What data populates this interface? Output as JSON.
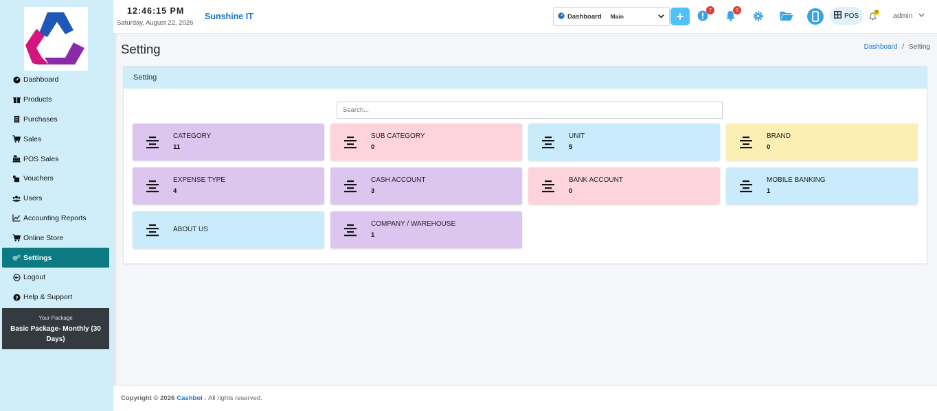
{
  "topbar": {
    "time": "12:46:15 PM",
    "date": "Saturday, August 22, 2026",
    "company": "Sunshine IT",
    "dashboard_label": "Dashboard",
    "dashboard_value": "Main",
    "plus_label": "+",
    "notif1_count": "7",
    "notif2_count": "0",
    "bell_count": "0",
    "pos_label": "POS",
    "user": "admin"
  },
  "sidebar": {
    "items": [
      {
        "label": "Dashboard",
        "icon": "gauge-icon"
      },
      {
        "label": "Products",
        "icon": "box-icon"
      },
      {
        "label": "Purchases",
        "icon": "clipboard-icon"
      },
      {
        "label": "Sales",
        "icon": "cart-icon"
      },
      {
        "label": "POS Sales",
        "icon": "cash-register-icon"
      },
      {
        "label": "Vouchers",
        "icon": "voucher-icon"
      },
      {
        "label": "Users",
        "icon": "users-icon"
      },
      {
        "label": "Accounting Reports",
        "icon": "chart-line-icon"
      },
      {
        "label": "Online Store",
        "icon": "cart-icon"
      },
      {
        "label": "Settings",
        "icon": "cogs-icon"
      },
      {
        "label": "Logout",
        "icon": "logout-icon"
      },
      {
        "label": "Help & Support",
        "icon": "question-icon"
      }
    ],
    "active_index": 9,
    "package_label": "Your Package",
    "package_name": "Basic Package- Monthly (30 Days)"
  },
  "page": {
    "title": "Setting",
    "breadcrumb": [
      "Dashboard",
      "/",
      "Setting"
    ]
  },
  "card": {
    "header": "Setting",
    "search_placeholder": "Search...",
    "tiles": [
      {
        "name": "CATEGORY",
        "count": "11",
        "color": "#dcc6ef"
      },
      {
        "name": "SUB CATEGORY",
        "count": "0",
        "color": "#fdd4dc"
      },
      {
        "name": "UNIT",
        "count": "5",
        "color": "#c9ebfb"
      },
      {
        "name": "BRAND",
        "count": "0",
        "color": "#fcefb4"
      },
      {
        "name": "EXPENSE TYPE",
        "count": "4",
        "color": "#dcc6ef"
      },
      {
        "name": "CASH ACCOUNT",
        "count": "3",
        "color": "#dcc6ef"
      },
      {
        "name": "BANK ACCOUNT",
        "count": "0",
        "color": "#fdd4dc"
      },
      {
        "name": "MOBILE BANKING",
        "count": "1",
        "color": "#c9ebfb"
      },
      {
        "name": "ABOUT US",
        "count": "",
        "color": "#c9ebfb"
      },
      {
        "name": "COMPANY / WAREHOUSE",
        "count": "1",
        "color": "#dcc6ef"
      }
    ]
  },
  "footer": {
    "copyright": "Copyright © 2026",
    "brand": "Cashboi .",
    "rest": "All rights reserved."
  },
  "colors": {
    "sidebar_bg": "#d0eef9",
    "active_bg": "#0b7a83",
    "accent_blue": "#1a73c8",
    "plus_btn": "#4fc3f7",
    "badge_red": "#e53935"
  }
}
